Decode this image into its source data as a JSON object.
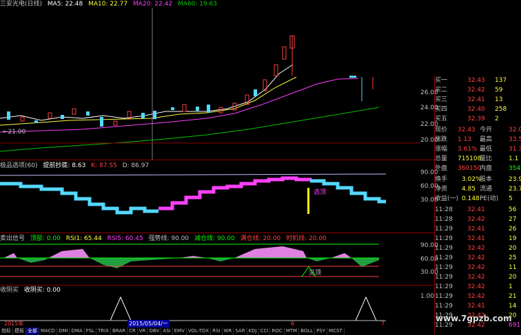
{
  "main_header": {
    "title": "三安光电(日线)",
    "ma5": "MA5: 22.48",
    "ma10": "MA10: 22.77",
    "ma20": "MA20: 22.42",
    "ma60": "MA60: 19.63"
  },
  "main_axis": [
    "26.00",
    "24.00",
    "22.00",
    "20.00"
  ],
  "low_marker": "21.00",
  "ind1_header": {
    "title": "极品选项(60)",
    "sub": "提前抄底: 8.63",
    "k": "K: 87.55",
    "d": "D: 86.97"
  },
  "ind1_axis": [
    "90.00",
    "60.00",
    "30.00"
  ],
  "ind1_label": "选顶",
  "ind2_header": {
    "title": "卖出信号",
    "top": "顶部: 0.00",
    "rsi1": "RSI1: 65.44",
    "rsi5": "RSI5: 60.45",
    "strong": "强势线: 90.00",
    "reduce": "减仓线: 90.00",
    "position": "满仓线: 20.00",
    "time": "时机线: 20.00"
  },
  "ind2_axis": [
    "90.00",
    "60.00",
    "30.00"
  ],
  "ind2_label": "见顶",
  "ind3_header": {
    "title": "收阴买",
    "val": "收阴买: 0.00"
  },
  "ind3_axis": [
    "1.00"
  ],
  "timeline": {
    "year": "2015年",
    "cursor_date": "2015/05/04/一",
    "m6": "6",
    "m7": "7"
  },
  "order_book": [
    {
      "label": "买一",
      "price": "32.43",
      "vol": "137"
    },
    {
      "label": "买二",
      "price": "32.42",
      "vol": "59"
    },
    {
      "label": "买三",
      "price": "32.41",
      "vol": "13"
    },
    {
      "label": "买四",
      "price": "32.40",
      "vol": "258"
    },
    {
      "label": "买五",
      "price": "32.39",
      "vol": "2"
    }
  ],
  "quote": [
    {
      "l": "现价",
      "v": "32.43",
      "l2": "今开",
      "v2": "32.0"
    },
    {
      "l": "涨跌",
      "v": "1.13",
      "l2": "最高",
      "v2": "33.5"
    },
    {
      "l": "涨幅",
      "v": "3.61%",
      "l2": "最低",
      "v2": "31.3"
    },
    {
      "l": "总量",
      "v": "715108",
      "l2": "量比",
      "v2": "1.1"
    },
    {
      "l": "外盘",
      "v": "360150",
      "l2": "内盘",
      "v2": "35495"
    }
  ],
  "stats": [
    {
      "l": "换手",
      "v": "3.02%",
      "l2": "股本",
      "v2": "23.9"
    },
    {
      "l": "净资",
      "v": "4.85",
      "l2": "流通",
      "v2": "23.7"
    },
    {
      "l": "收益(一)",
      "v": "0.148",
      "l2": "PE(动)",
      "v2": "5"
    }
  ],
  "ticks": [
    {
      "t": "11:28",
      "p": "32.41",
      "v": "56"
    },
    {
      "t": "11:28",
      "p": "32.42",
      "v": "27"
    },
    {
      "t": "11:29",
      "p": "32.41",
      "v": "26"
    },
    {
      "t": "11:29",
      "p": "32.41",
      "v": "19"
    },
    {
      "t": "11:29",
      "p": "32.42",
      "v": "20"
    },
    {
      "t": "11:29",
      "p": "32.42",
      "v": "25"
    },
    {
      "t": "11:29",
      "p": "32.42",
      "v": "11"
    },
    {
      "t": "11:29",
      "p": "32.42",
      "v": "20"
    },
    {
      "t": "11:29",
      "p": "32.42",
      "v": "1"
    },
    {
      "t": "11:29",
      "p": "32.42",
      "v": "21"
    },
    {
      "t": "11:29",
      "p": "32.41",
      "v": "14"
    },
    {
      "t": "11:29",
      "p": "32.42",
      "v": "20"
    },
    {
      "t": "11:29",
      "p": "32.42",
      "v": "691"
    }
  ],
  "tabs": [
    "指标",
    "模板",
    "全部",
    "MACD",
    "DMI",
    "DMA",
    "FSL",
    "TRIX",
    "BRAR",
    "CR",
    "VR",
    "OBV",
    "ASI",
    "EMV",
    "VOL-TDX",
    "RSI",
    "WR",
    "SAR",
    "KDJ",
    "CCI",
    "ROC",
    "MTM",
    "BOLL",
    "PSY",
    "MCST"
  ],
  "watermark": "www.7gpzb.com",
  "colors": {
    "up": "#ff4040",
    "down": "#54d8ff",
    "ma5": "#ffffff",
    "ma10": "#ffff40",
    "ma20": "#ff40ff",
    "ma60": "#00c800"
  }
}
